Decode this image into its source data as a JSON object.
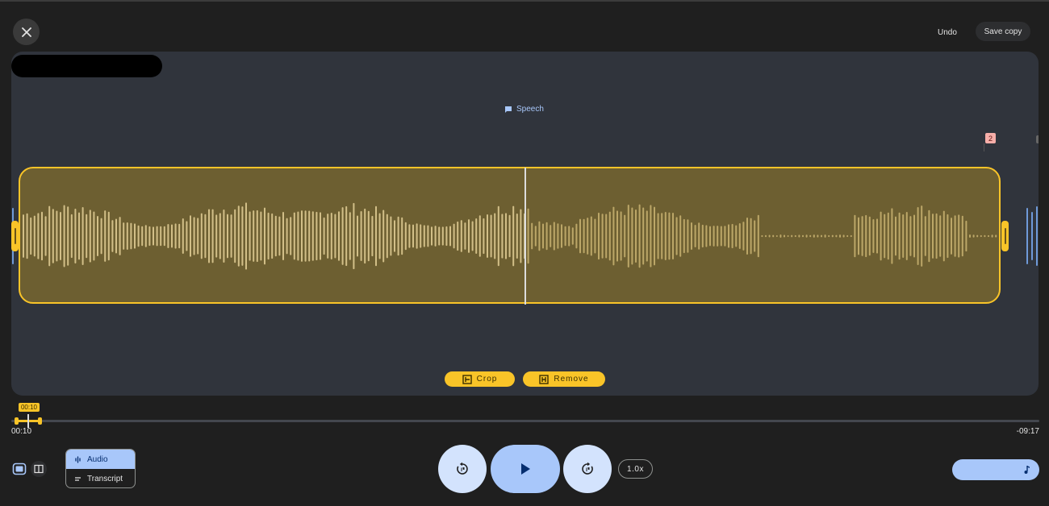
{
  "header": {
    "close_icon": "close-icon",
    "undo_label": "Undo",
    "save_copy_label": "Save copy"
  },
  "editor": {
    "speech_label": "Speech",
    "marker_number": "2",
    "crop_label": "Crop",
    "remove_label": "Remove"
  },
  "timeline": {
    "handle_time": "00:10",
    "elapsed": "00:10",
    "remaining": "-09:17"
  },
  "view_toggle": {
    "audio_label": "Audio",
    "transcript_label": "Transcript"
  },
  "playback": {
    "speed_label": "1.0x"
  },
  "colors": {
    "selection_border": "#f9c428",
    "primary_blue": "#a8c7fa",
    "editor_bg": "#30343c"
  }
}
